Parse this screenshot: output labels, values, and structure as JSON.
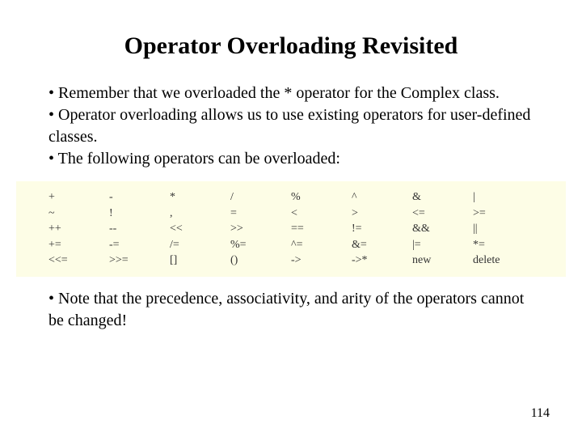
{
  "title": "Operator Overloading Revisited",
  "bullets": {
    "b1": "• Remember that we overloaded the * operator for the Complex class.",
    "b2": "• Operator overloading allows us to use existing operators for user-defined classes.",
    "b3": "• The following operators can be overloaded:",
    "b4": "• Note that the precedence, associativity, and arity of the operators cannot be changed!"
  },
  "ops": {
    "r0": [
      "+",
      "-",
      "*",
      "/",
      "%",
      "^",
      "&",
      "|"
    ],
    "r1": [
      "~",
      "!",
      ",",
      "=",
      "<",
      ">",
      "<=",
      ">="
    ],
    "r2": [
      "++",
      "--",
      "<<",
      ">>",
      "==",
      "!=",
      "&&",
      "||"
    ],
    "r3": [
      "+=",
      "-=",
      "/=",
      "%=",
      "^=",
      "&=",
      "|=",
      "*="
    ],
    "r4": [
      "<<=",
      ">>=",
      "[]",
      "()",
      "->",
      "->*",
      "new",
      "delete"
    ]
  },
  "page_number": "114"
}
